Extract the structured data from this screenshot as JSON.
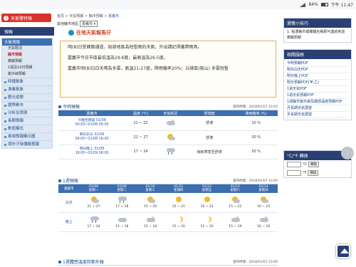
{
  "status_bar": {
    "battery": "84%",
    "time": "下午 11:47"
  },
  "left": {
    "alert_label": "天氣警特報",
    "section_title": "預報",
    "menu_top": "天氣預報",
    "submenu": [
      "天氣概況",
      "縣市預報",
      "鄉鎮預報",
      "1週及10日預報",
      "紫外線預報"
    ],
    "items": [
      "時鐘氣象",
      "漁業氣象",
      "觀光遊憩",
      "國際都市",
      "分析及預測",
      "長期預報",
      "數值模式",
      "風場預報顯示圖",
      "境外汙染傳輸預報"
    ]
  },
  "center": {
    "breadcrumb": [
      "首頁",
      "天氣預報",
      "縣市預報",
      "嘉義市"
    ],
    "city_label": "其他縣市地區",
    "city_value": "嘉義市",
    "title": "在地天氣報馬仔",
    "notice": [
      "明(8)日受鋒面通過，局部地區為短暫雨的天氣，外出請記得攜帶雨具。",
      "嘉義市今日市區最低溫為19.6度，最高溫為26.5度。",
      "嘉義市明(8)日白天晴為多雲，氣溫21-27度，降雨機率20%；丘陵區(阪山) 多雲短暫"
    ],
    "today": {
      "title": "今明預報",
      "published": "發布時間：2018/01/07 23:00",
      "headers": [
        "嘉義市",
        "溫度 (°C)",
        "天氣狀況",
        "舒適度",
        "降雨機率 (%)"
      ],
      "rows": [
        {
          "period": "今晚至明晨 01/08",
          "time": "00:00~01/08 06:00",
          "temp": "21 ~ 22",
          "icon": "partly-cloudy-night-icon",
          "comfort": "舒適",
          "rain": "10 %"
        },
        {
          "period": "明日白天 01/08",
          "time": "06:00~01/08 18:00",
          "temp": "21 ~ 27",
          "icon": "partly-cloudy-day-icon",
          "comfort": "舒適",
          "rain": "20 %"
        },
        {
          "period": "明日晚上 01/08",
          "time": "18:00~01/09 06:00",
          "temp": "17 ~ 24",
          "icon": "cloudy-rain-icon",
          "comfort": "稍有寒意至舒適",
          "rain": "50 %"
        }
      ]
    },
    "week": {
      "title": "1週預報",
      "published": "發布時間：2018/01/07 23:00",
      "city": "嘉義市",
      "days": [
        {
          "date": "01/08",
          "wd": "星期一"
        },
        {
          "date": "01/09",
          "wd": "星期二"
        },
        {
          "date": "01/10",
          "wd": "星期三"
        },
        {
          "date": "01/11",
          "wd": "星期四"
        },
        {
          "date": "01/12",
          "wd": "星期五"
        },
        {
          "date": "01/13",
          "wd": "星期六"
        },
        {
          "date": "01/14",
          "wd": "星期日"
        }
      ],
      "day_label": "白天",
      "night_label": "晚上",
      "day_temps": [
        "21 ~ 27",
        "17 ~ 18",
        "15 ~ 20",
        "15 ~ 21",
        "16 ~ 22",
        "15 ~ 22",
        "16 ~ 23"
      ],
      "night_temps": [
        "17 ~ 24",
        "15 ~ 18",
        "15 ~ 18",
        "15 ~ 20",
        "15 ~ 20",
        "15 ~ 19",
        "16 ~ 19"
      ]
    },
    "uv_title": "1週體感溫度和紫外線",
    "uv_published": "發布時間：2018/01/07 23:00"
  },
  "right": {
    "tips_title": "瀏覽小技巧",
    "tips_text": "1. 點選縣市或鄉鎮名稱即可連結到該鄉鎮預報",
    "related_title": "相關服務",
    "related": [
      "今明預報PDF",
      "明日白天PDF",
      "明日晚上PDF",
      "明日預報PDF(甲,乙)",
      "1週天氣PDF",
      "1週天氣預報PDF",
      "1週縣市紫外線及體感溫度預報PDF",
      "丹長期天氣展望",
      "冬長期天氣展望"
    ],
    "conv_title": "°C/°F 轉換",
    "conv_btn": "轉換",
    "conv_c": "°C",
    "conv_f": "°F"
  }
}
